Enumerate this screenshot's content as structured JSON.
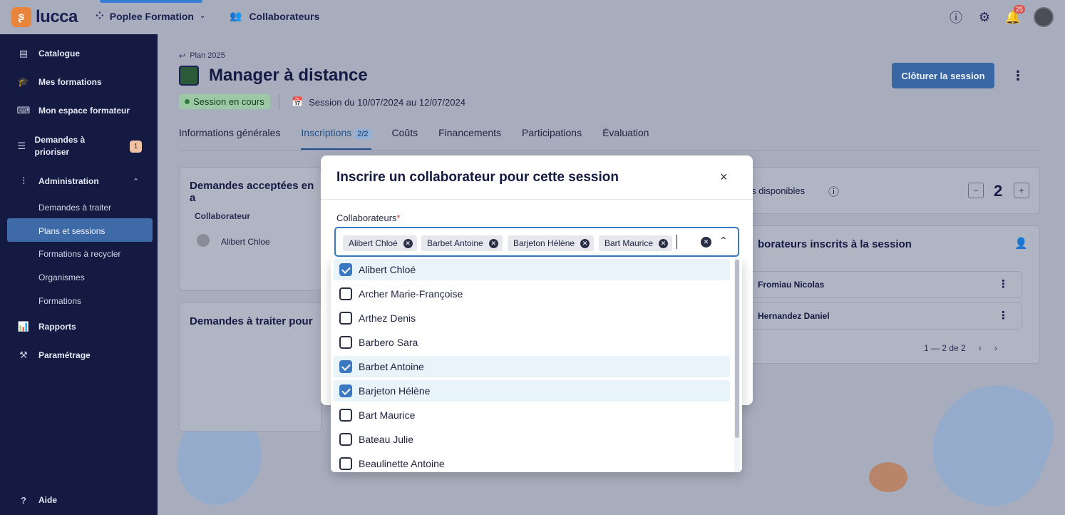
{
  "topbar": {
    "logo_text": "lucca",
    "app_name": "Poplee Formation",
    "module_name": "Collaborateurs",
    "notif_count": "25"
  },
  "sidebar": {
    "items": [
      {
        "label": "Catalogue",
        "icon": "book-icon"
      },
      {
        "label": "Mes formations",
        "icon": "graduation-icon"
      },
      {
        "label": "Mon espace formateur",
        "icon": "trainer-icon"
      },
      {
        "label": "Demandes à prioriser",
        "icon": "list-icon",
        "badge": "1"
      },
      {
        "label": "Administration",
        "icon": "sliders-icon"
      }
    ],
    "admin_sub": [
      "Demandes à traiter",
      "Plans et sessions",
      "Formations à recycler",
      "Organismes",
      "Formations"
    ],
    "bottom_items": [
      {
        "label": "Rapports",
        "icon": "chart-icon"
      },
      {
        "label": "Paramétrage",
        "icon": "tools-icon"
      }
    ],
    "help_label": "Aide"
  },
  "page": {
    "breadcrumb": "Plan 2025",
    "title": "Manager à distance",
    "status": "Session en cours",
    "session_dates": "Session du 10/07/2024 au 12/07/2024",
    "close_button": "Clôturer la session",
    "tabs": [
      {
        "label": "Informations générales"
      },
      {
        "label": "Inscriptions",
        "count": "2/2"
      },
      {
        "label": "Coûts"
      },
      {
        "label": "Financements"
      },
      {
        "label": "Participations"
      },
      {
        "label": "Évaluation"
      }
    ]
  },
  "cards": {
    "accepted_title": "Demandes acceptées en a",
    "col_collaborateur": "Collaborateur",
    "accepted_row": "Alibert Chloe",
    "todo_title": "Demandes à traiter pour",
    "places_label": "s disponibles",
    "places_count": "2",
    "enrolled_title": "borateurs inscrits à la session",
    "enrolled": [
      "Fromiau Nicolas",
      "Hernandez Daniel"
    ],
    "pager": "1 — 2 de 2"
  },
  "modal": {
    "title": "Inscrire un collaborateur pour cette session",
    "field_label": "Collaborateurs",
    "required_mark": "*",
    "chips": [
      "Alibert Chloé",
      "Barbet Antoine",
      "Barjeton Hélène",
      "Bart Maurice"
    ]
  },
  "dropdown": {
    "options": [
      {
        "label": "Alibert Chloé",
        "checked": true
      },
      {
        "label": "Archer Marie-Françoise",
        "checked": false
      },
      {
        "label": "Arthez Denis",
        "checked": false
      },
      {
        "label": "Barbero Sara",
        "checked": false
      },
      {
        "label": "Barbet Antoine",
        "checked": true
      },
      {
        "label": "Barjeton Hélène",
        "checked": true
      },
      {
        "label": "Bart Maurice",
        "checked": false
      },
      {
        "label": "Bateau Julie",
        "checked": false
      },
      {
        "label": "Beaulinette Antoine",
        "checked": false
      }
    ]
  }
}
